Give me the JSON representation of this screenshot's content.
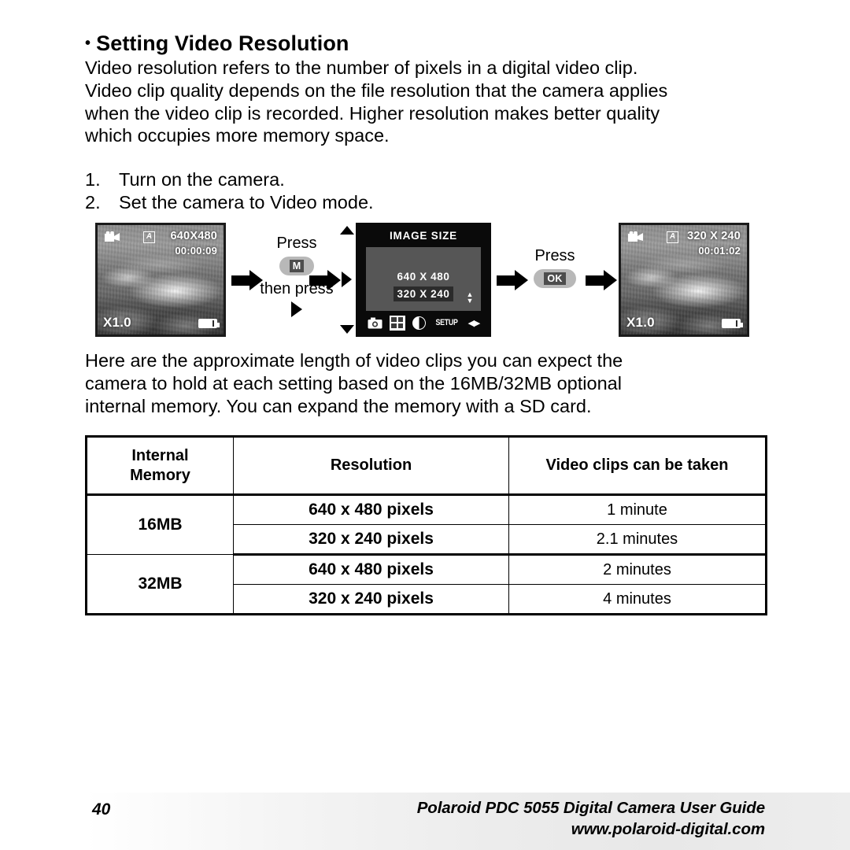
{
  "heading": {
    "bullet": "•",
    "title": "Setting Video Resolution"
  },
  "intro_paragraph": {
    "line1": "Video resolution refers to the number of pixels in a digital video clip.",
    "line2": "Video clip quality depends on the file resolution that the camera applies",
    "line3": "when the video clip is recorded. Higher resolution makes better quality",
    "line4": "which occupies more memory space."
  },
  "steps": [
    {
      "num": "1.",
      "text": "Turn on the camera."
    },
    {
      "num": "2.",
      "text": "Set the camera to Video mode."
    }
  ],
  "diagram": {
    "lcd_before": {
      "resolution": "640X480",
      "timecode": "00:00:09",
      "zoom": "X1.0",
      "video_icon": "video-camera-icon",
      "auto_icon": "A",
      "battery_icon": "battery-icon"
    },
    "press_m_group": {
      "label": "Press",
      "button": "M",
      "then_label": "then press",
      "arrow": "right-arrow-icon"
    },
    "menu_screen": {
      "title": "IMAGE SIZE",
      "options": [
        {
          "label": "640 X 480",
          "selected": false
        },
        {
          "label": "320 X 240",
          "selected": true
        }
      ],
      "updown_indicator": "up-down-arrows-icon",
      "tabs": [
        {
          "name": "camera-tab-icon",
          "label": ""
        },
        {
          "name": "image-size-tab-icon",
          "label": ""
        },
        {
          "name": "contrast-tab-icon",
          "label": ""
        },
        {
          "name": "setup-tab",
          "label": "SETUP"
        },
        {
          "name": "left-right-arrows-icon",
          "label": ""
        }
      ]
    },
    "press_ok_group": {
      "label": "Press",
      "button": "OK"
    },
    "lcd_after": {
      "resolution": "320 X 240",
      "timecode": "00:01:02",
      "zoom": "X1.0",
      "video_icon": "video-camera-icon",
      "auto_icon": "A",
      "battery_icon": "battery-icon"
    }
  },
  "memory_paragraph": {
    "line1": "Here are the approximate length of video clips you can expect the",
    "line2": "camera to hold at each setting based on the 16MB/32MB optional",
    "line3": "internal memory. You can expand the memory with a SD card."
  },
  "table": {
    "headers": {
      "memory": "Internal\nMemory",
      "memory_line1": "Internal",
      "memory_line2": "Memory",
      "resolution": "Resolution",
      "clips": "Video clips can be taken"
    },
    "groups": [
      {
        "memory": "16MB",
        "rows": [
          {
            "resolution": "640 x 480 pixels",
            "clips": "1 minute"
          },
          {
            "resolution": "320 x 240 pixels",
            "clips": "2.1 minutes"
          }
        ]
      },
      {
        "memory": "32MB",
        "rows": [
          {
            "resolution": "640 x 480 pixels",
            "clips": "2 minutes"
          },
          {
            "resolution": "320 x 240 pixels",
            "clips": "4 minutes"
          }
        ]
      }
    ]
  },
  "footer": {
    "page_number": "40",
    "guide_title": "Polaroid PDC 5055 Digital Camera User Guide",
    "website": "www.polaroid-digital.com"
  }
}
